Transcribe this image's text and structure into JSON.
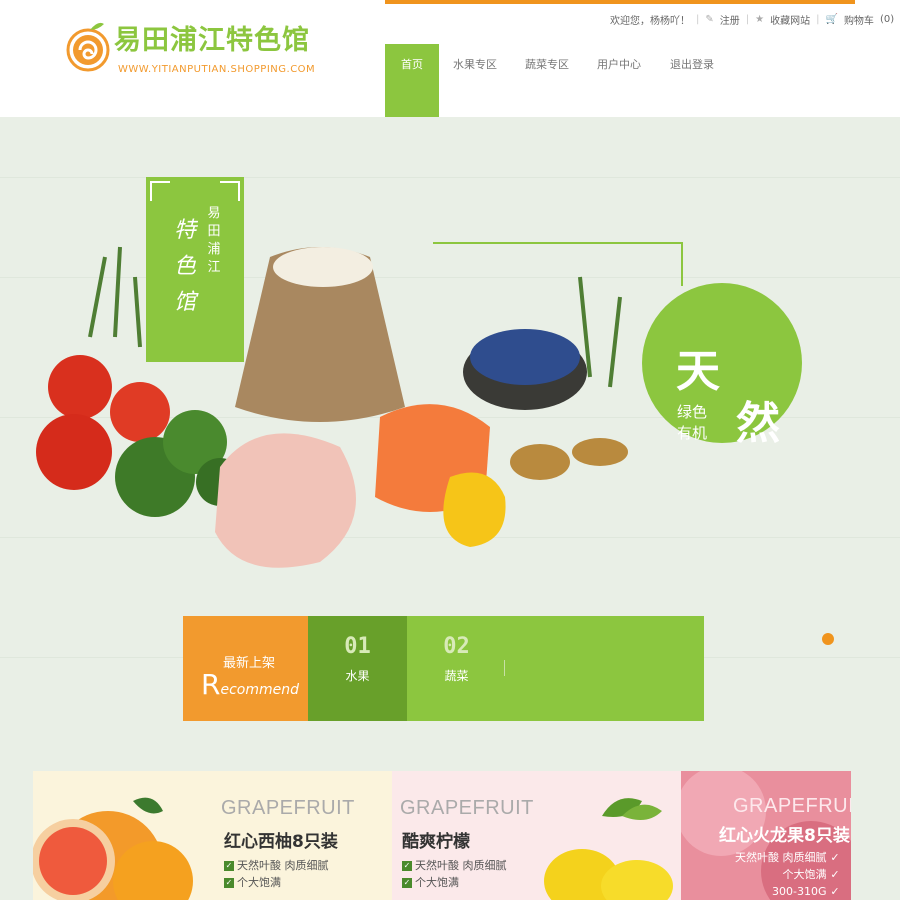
{
  "brand": {
    "name": "易田浦江特色馆",
    "url_text": "WWW.YITIANPUTIAN.SHOPPING.COM"
  },
  "topbar": {
    "welcome": "欢迎您，杨杨吖！",
    "register": "注册",
    "favorite": "收藏网站",
    "cart": "购物车",
    "cart_count": "(0)"
  },
  "nav": {
    "items": [
      "首页",
      "水果专区",
      "蔬菜专区",
      "用户中心",
      "退出登录"
    ],
    "active_index": 0
  },
  "banner": {
    "seal_top": "易田浦江",
    "seal_main": "特色馆",
    "circle_big_1": "天",
    "circle_big_2": "然",
    "circle_small_1": "绿色",
    "circle_small_2": "有机"
  },
  "recommend": {
    "cn": "最新上架",
    "en_initial": "R",
    "en_rest": "ecommend",
    "tabs": [
      {
        "num": "01",
        "label": "水果"
      },
      {
        "num": "02",
        "label": "蔬菜"
      }
    ]
  },
  "products": [
    {
      "en": "GRAPEFRUIT",
      "title": "红心西柚8只装",
      "features": [
        "天然叶酸 肉质细腻",
        "个大饱满"
      ]
    },
    {
      "en": "GRAPEFRUIT",
      "title": "酷爽柠檬",
      "features": [
        "天然叶酸 肉质细腻",
        "个大饱满"
      ]
    },
    {
      "en": "GRAPEFRUIT",
      "title": "红心火龙果8只装",
      "features": [
        "天然叶酸 肉质细腻",
        "个大饱满",
        "300-310G"
      ]
    }
  ],
  "colors": {
    "accent_green": "#8cc63f",
    "accent_orange": "#f29a2e"
  }
}
